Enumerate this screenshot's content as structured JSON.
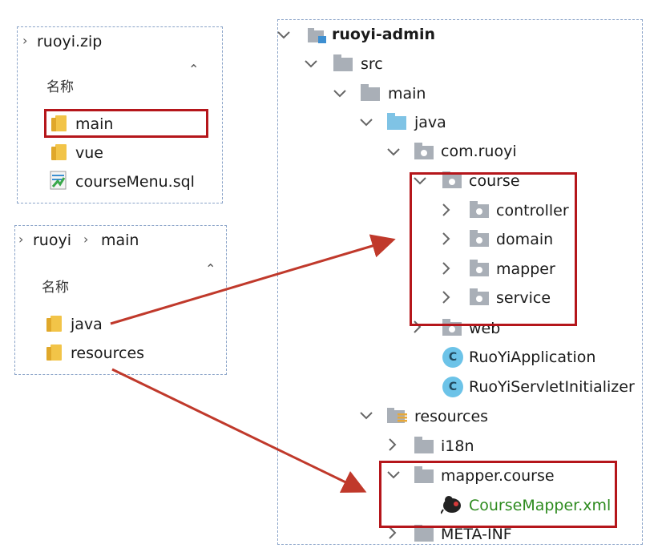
{
  "zip_panel": {
    "crumb": "ruoyi.zip",
    "column_header": "名称",
    "items": [
      {
        "label": "main"
      },
      {
        "label": "vue"
      },
      {
        "label": "courseMenu.sql"
      }
    ]
  },
  "folder_panel": {
    "crumbs": [
      "ruoyi",
      "main"
    ],
    "column_header": "名称",
    "items": [
      {
        "label": "java"
      },
      {
        "label": "resources"
      }
    ]
  },
  "project_tree": {
    "root": "ruoyi-admin",
    "nodes": {
      "src": "src",
      "main": "main",
      "java": "java",
      "com_ruoyi": "com.ruoyi",
      "course": "course",
      "controller": "controller",
      "domain": "domain",
      "mapper": "mapper",
      "service": "service",
      "web": "web",
      "ruoyi_application": "RuoYiApplication",
      "ruoyi_servlet_initializer": "RuoYiServletInitializer",
      "resources": "resources",
      "i18n": "i18n",
      "mapper_course": "mapper.course",
      "course_mapper_xml": "CourseMapper.xml",
      "meta_inf": "META-INF"
    }
  },
  "colors": {
    "highlight_box": "#b5161b",
    "arrow": "#c0392b",
    "xml_file_text": "#2e8b1f",
    "folder_yellow": "#f2c448",
    "idea_folder_gray": "#a9afb7",
    "idea_source_blue": "#7fc3e5"
  }
}
